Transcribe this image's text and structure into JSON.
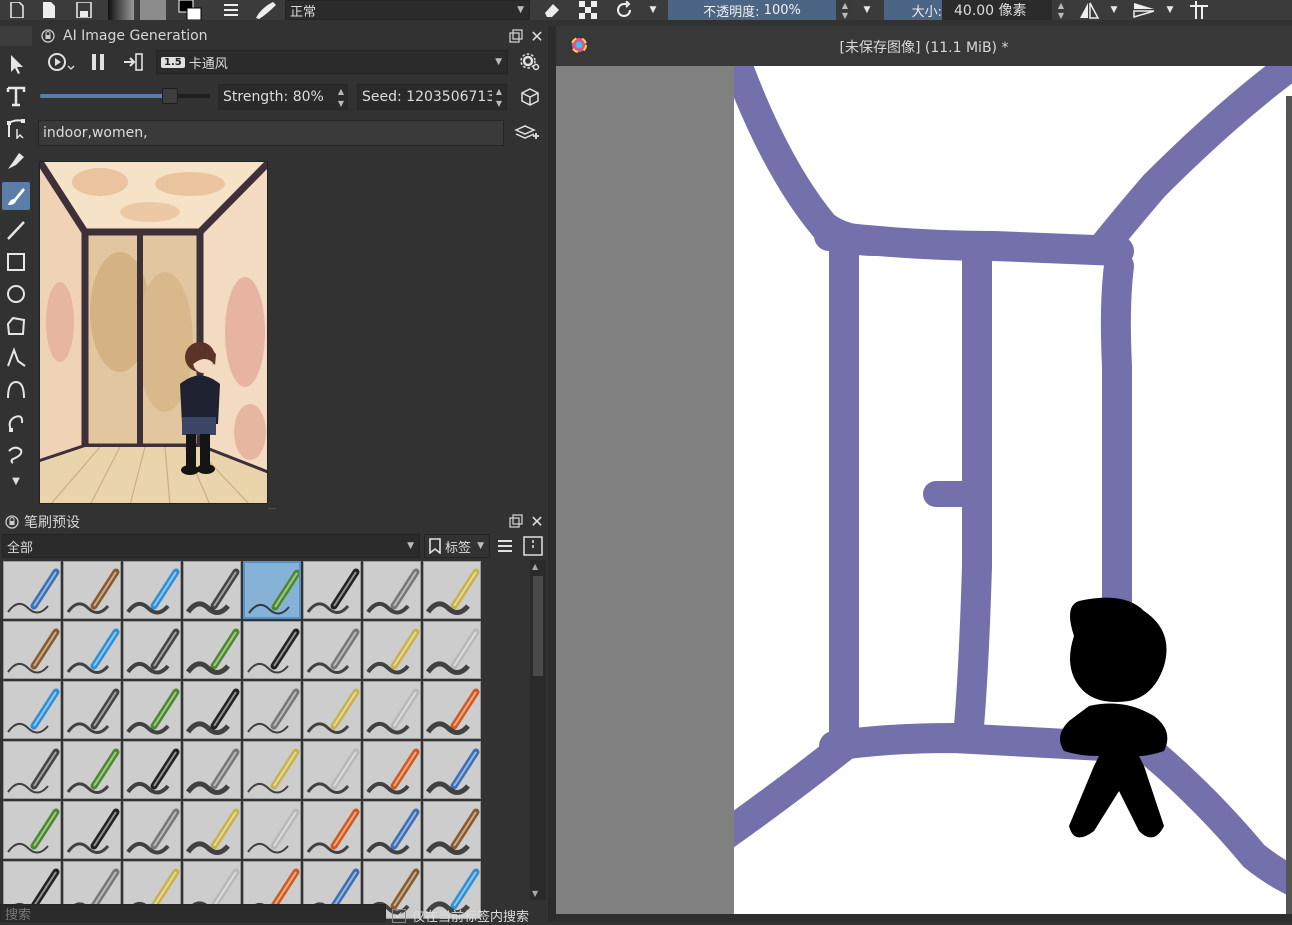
{
  "toolbar": {
    "blend_mode": "正常",
    "opacity_label": "不透明度:",
    "opacity_value": "100%",
    "size_label": "大小:",
    "size_value": "40.00 像素"
  },
  "ai_panel": {
    "title": "AI Image Generation",
    "model_badge": "1.5",
    "style": "卡通风",
    "strength": "Strength: 80%",
    "strength_fraction": 0.8,
    "seed": "Seed: 1203506713",
    "prompt": "indoor,women,"
  },
  "brush_panel": {
    "title": "笔刷预设",
    "filter": "全部",
    "tag_label": "标签",
    "search_placeholder": "搜索",
    "search_current_tag": "仅在当前标签内搜索",
    "search_current_tag_checked": true
  },
  "document": {
    "tab_title": "[未保存图像]  (11.1 MiB) *"
  },
  "colors": {
    "accent": "#5a7ea8",
    "stroke_purple": "#7370ab",
    "figure_black": "#000000"
  },
  "icons": [
    "new-document-icon",
    "open-document-icon",
    "save-icon",
    "gradient-icon",
    "pattern-icon",
    "fg-bg-color-icon",
    "brush-settings-icon",
    "brush-preset-icon",
    "eraser-icon",
    "alpha-lock-icon",
    "reload-icon",
    "mirror-x-icon",
    "mirror-y-icon",
    "wrap-icon"
  ]
}
